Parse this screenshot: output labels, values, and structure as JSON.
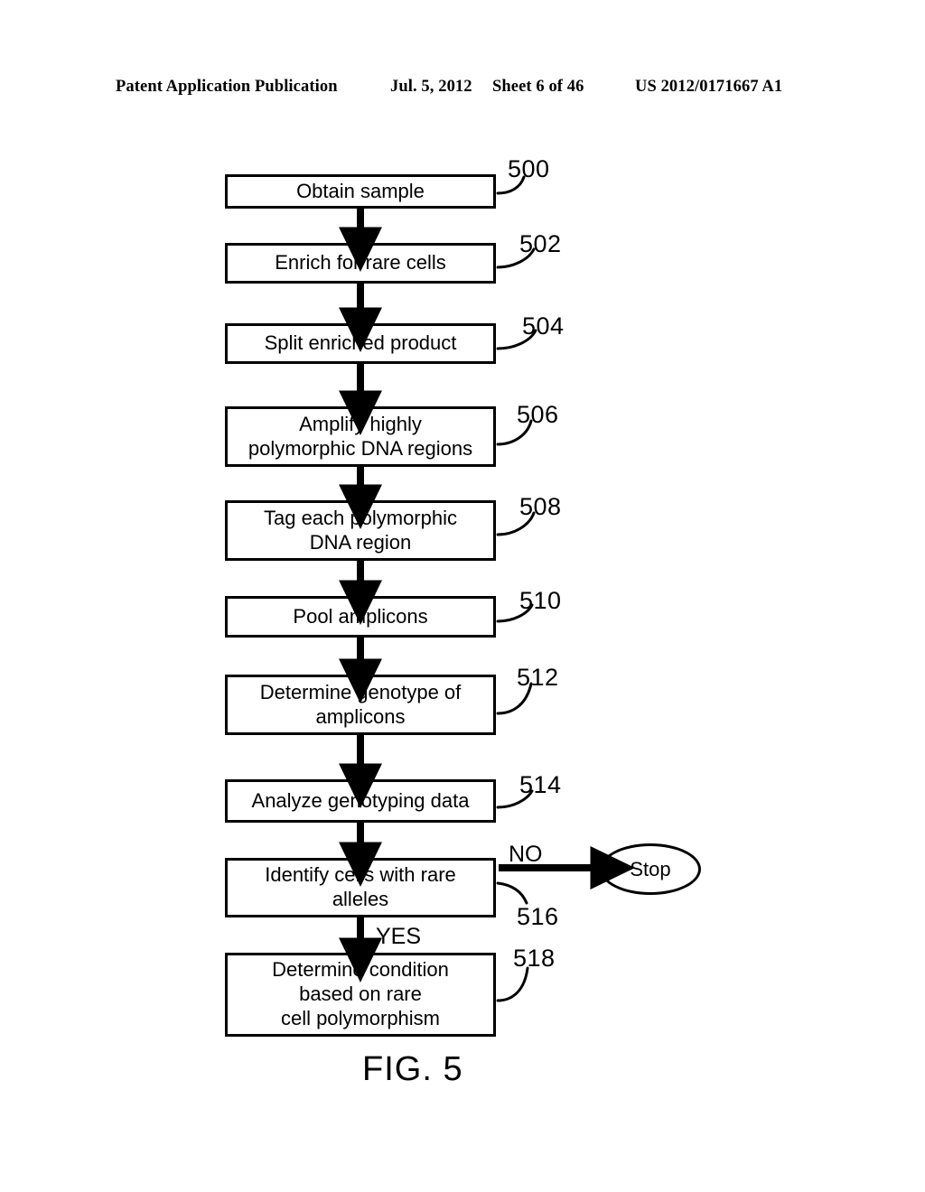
{
  "header": {
    "publication": "Patent Application Publication",
    "date": "Jul. 5, 2012",
    "sheet": "Sheet 6 of 46",
    "patent_number": "US 2012/0171667 A1"
  },
  "figure": {
    "caption": "FIG. 5",
    "type": "flowchart",
    "nodes": [
      {
        "ref": "500",
        "shape": "process",
        "lines": [
          "Obtain sample"
        ]
      },
      {
        "ref": "502",
        "shape": "process",
        "lines": [
          "Enrich for rare cells"
        ]
      },
      {
        "ref": "504",
        "shape": "process",
        "lines": [
          "Split enriched product"
        ]
      },
      {
        "ref": "506",
        "shape": "process",
        "lines": [
          "Amplify highly",
          "polymorphic DNA regions"
        ]
      },
      {
        "ref": "508",
        "shape": "process",
        "lines": [
          "Tag each polymorphic",
          "DNA region"
        ]
      },
      {
        "ref": "510",
        "shape": "process",
        "lines": [
          "Pool amplicons"
        ]
      },
      {
        "ref": "512",
        "shape": "process",
        "lines": [
          "Determine genotype of",
          "amplicons"
        ]
      },
      {
        "ref": "514",
        "shape": "process",
        "lines": [
          "Analyze genotyping data"
        ]
      },
      {
        "ref": "516",
        "shape": "decision",
        "lines": [
          "Identify cells with rare",
          "alleles"
        ]
      },
      {
        "ref": "518",
        "shape": "process",
        "lines": [
          "Determine condition",
          "based on rare",
          "cell polymorphism"
        ]
      }
    ],
    "terminal": {
      "label": "Stop"
    },
    "branches": {
      "no": "NO",
      "yes": "YES"
    },
    "line_color": "#000000",
    "fill_color": "#ffffff"
  }
}
